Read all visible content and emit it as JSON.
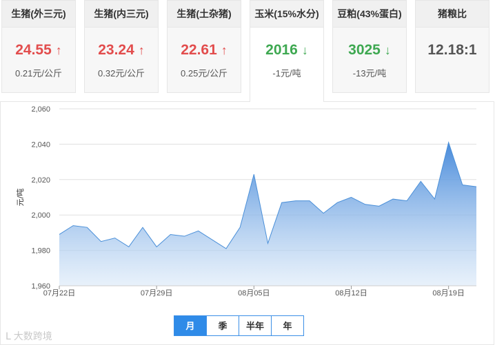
{
  "cards": [
    {
      "name": "生猪(外三元)",
      "price": "24.55",
      "arrow": "↑",
      "dir": "up",
      "change": "0.21元/公斤"
    },
    {
      "name": "生猪(内三元)",
      "price": "23.24",
      "arrow": "↑",
      "dir": "up",
      "change": "0.32元/公斤"
    },
    {
      "name": "生猪(土杂猪)",
      "price": "22.61",
      "arrow": "↑",
      "dir": "up",
      "change": "0.25元/公斤"
    },
    {
      "name": "玉米(15%水分)",
      "price": "2016",
      "arrow": "↓",
      "dir": "down",
      "change": "-1元/吨"
    },
    {
      "name": "豆粕(43%蛋白)",
      "price": "3025",
      "arrow": "↓",
      "dir": "down",
      "change": "-13元/吨"
    },
    {
      "name": "猪粮比",
      "price": "12.18:1",
      "arrow": "",
      "dir": "neutral",
      "change": ""
    }
  ],
  "colors": {
    "up": "#e24d4d",
    "down": "#3ea851",
    "line": "#4a8fd8",
    "fill_top": "#3f85d9",
    "fill_bottom": "#d9e8f8",
    "grid": "#e0e0e0",
    "active_button": "#2f8be8"
  },
  "chart_data": {
    "type": "area",
    "ylabel": "元/吨",
    "ylim": [
      1960,
      2060
    ],
    "yticks": [
      "1,960",
      "1,980",
      "2,000",
      "2,020",
      "2,040",
      "2,060"
    ],
    "ytick_values": [
      1960,
      1980,
      2000,
      2020,
      2040,
      2060
    ],
    "xtick_labels": [
      "07月22日",
      "07月29日",
      "08月05日",
      "08月12日",
      "08月19日"
    ],
    "xtick_index": [
      0,
      7,
      14,
      21,
      28
    ],
    "x": [
      "07-22",
      "07-23",
      "07-24",
      "07-25",
      "07-26",
      "07-27",
      "07-28",
      "07-29",
      "07-30",
      "07-31",
      "08-01",
      "08-02",
      "08-03",
      "08-04",
      "08-05",
      "08-06",
      "08-07",
      "08-08",
      "08-09",
      "08-10",
      "08-11",
      "08-12",
      "08-13",
      "08-14",
      "08-15",
      "08-16",
      "08-17",
      "08-18",
      "08-19",
      "08-20",
      "08-21"
    ],
    "values": [
      1989,
      1994,
      1993,
      1985,
      1987,
      1982,
      1993,
      1982,
      1989,
      1988,
      1991,
      1986,
      1981,
      1993,
      2023,
      1984,
      2007,
      2008,
      2008,
      2001,
      2007,
      2010,
      2006,
      2005,
      2009,
      2008,
      2019,
      2009,
      2041,
      2017,
      2016
    ],
    "grid": true
  },
  "buttons": [
    {
      "label": "月",
      "active": true
    },
    {
      "label": "季",
      "active": false
    },
    {
      "label": "半年",
      "active": false
    },
    {
      "label": "年",
      "active": false
    }
  ],
  "watermark": "大数跨境"
}
